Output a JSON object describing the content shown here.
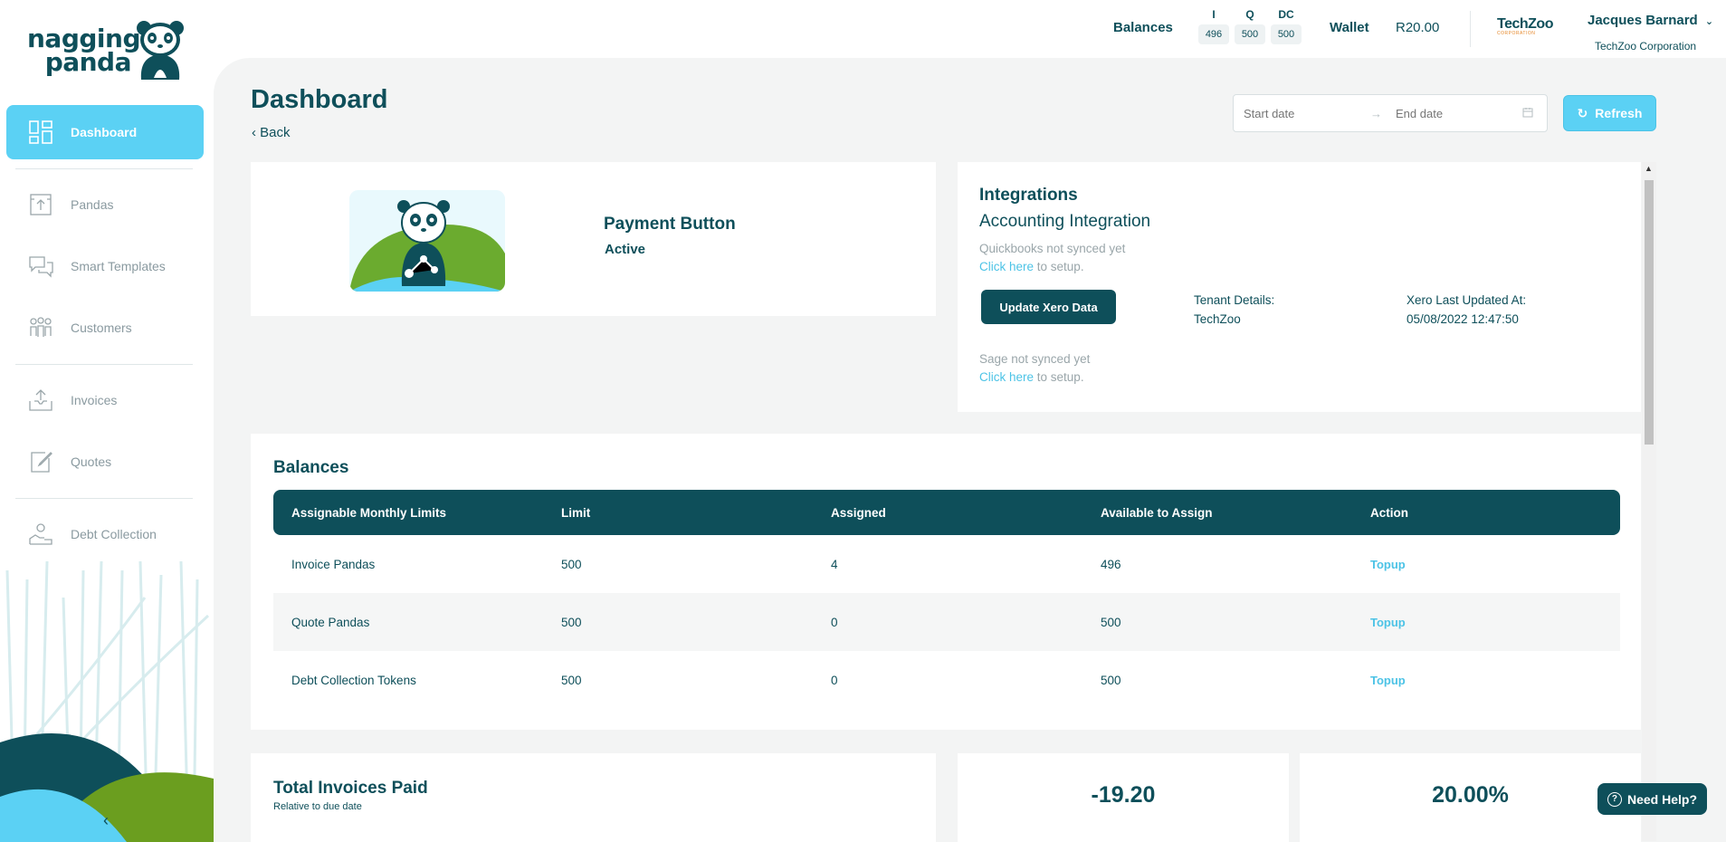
{
  "brand": {
    "line1": "nagging",
    "line2": "panda"
  },
  "sidebar": {
    "items": [
      {
        "label": "Dashboard",
        "icon": "dashboard-icon",
        "active": true
      },
      {
        "label": "Pandas",
        "icon": "pandas-icon"
      },
      {
        "label": "Smart Templates",
        "icon": "chat-icon"
      },
      {
        "label": "Customers",
        "icon": "customers-icon"
      },
      {
        "label": "Invoices",
        "icon": "upload-icon"
      },
      {
        "label": "Quotes",
        "icon": "edit-icon"
      },
      {
        "label": "Debt Collection",
        "icon": "debt-icon"
      }
    ],
    "collapse_icon": "‹"
  },
  "topbar": {
    "balances_label": "Balances",
    "balances": [
      {
        "key": "I",
        "value": "496"
      },
      {
        "key": "Q",
        "value": "500"
      },
      {
        "key": "DC",
        "value": "500"
      }
    ],
    "wallet_label": "Wallet",
    "wallet_value": "R20.00",
    "org_logo_main": "TechZoo",
    "org_logo_sub": "CORPORATION",
    "user_name": "Jacques Barnard",
    "user_company": "TechZoo Corporation"
  },
  "page": {
    "title": "Dashboard",
    "back": "‹ Back",
    "start_placeholder": "Start date",
    "end_placeholder": "End date",
    "refresh": "Refresh"
  },
  "payment": {
    "title": "Payment Button",
    "status": "Active"
  },
  "integrations": {
    "title": "Integrations",
    "subtitle": "Accounting Integration",
    "quickbooks_status": "Quickbooks not synced yet",
    "click_here": "Click here",
    "to_setup": " to setup.",
    "xero_button": "Update Xero Data",
    "tenant_label": "Tenant Details:",
    "tenant_value": "TechZoo",
    "xero_updated_label": "Xero Last Updated At:",
    "xero_updated_value": "05/08/2022 12:47:50",
    "sage_status": "Sage not synced yet"
  },
  "balances_table": {
    "title": "Balances",
    "headers": [
      "Assignable Monthly Limits",
      "Limit",
      "Assigned",
      "Available to Assign",
      "Action"
    ],
    "rows": [
      [
        "Invoice Pandas",
        "500",
        "4",
        "496",
        "Topup"
      ],
      [
        "Quote Pandas",
        "500",
        "0",
        "500",
        "Topup"
      ],
      [
        "Debt Collection Tokens",
        "500",
        "0",
        "500",
        "Topup"
      ]
    ]
  },
  "total_invoices": {
    "title": "Total Invoices Paid",
    "subtitle": "Relative to due date"
  },
  "stats": {
    "value1": "-19.20",
    "value2": "20.00%"
  },
  "help": {
    "label": "Need Help?"
  },
  "colors": {
    "primary": "#0e4f5a",
    "accent": "#5bd1f4",
    "green": "#6b9e1f"
  }
}
